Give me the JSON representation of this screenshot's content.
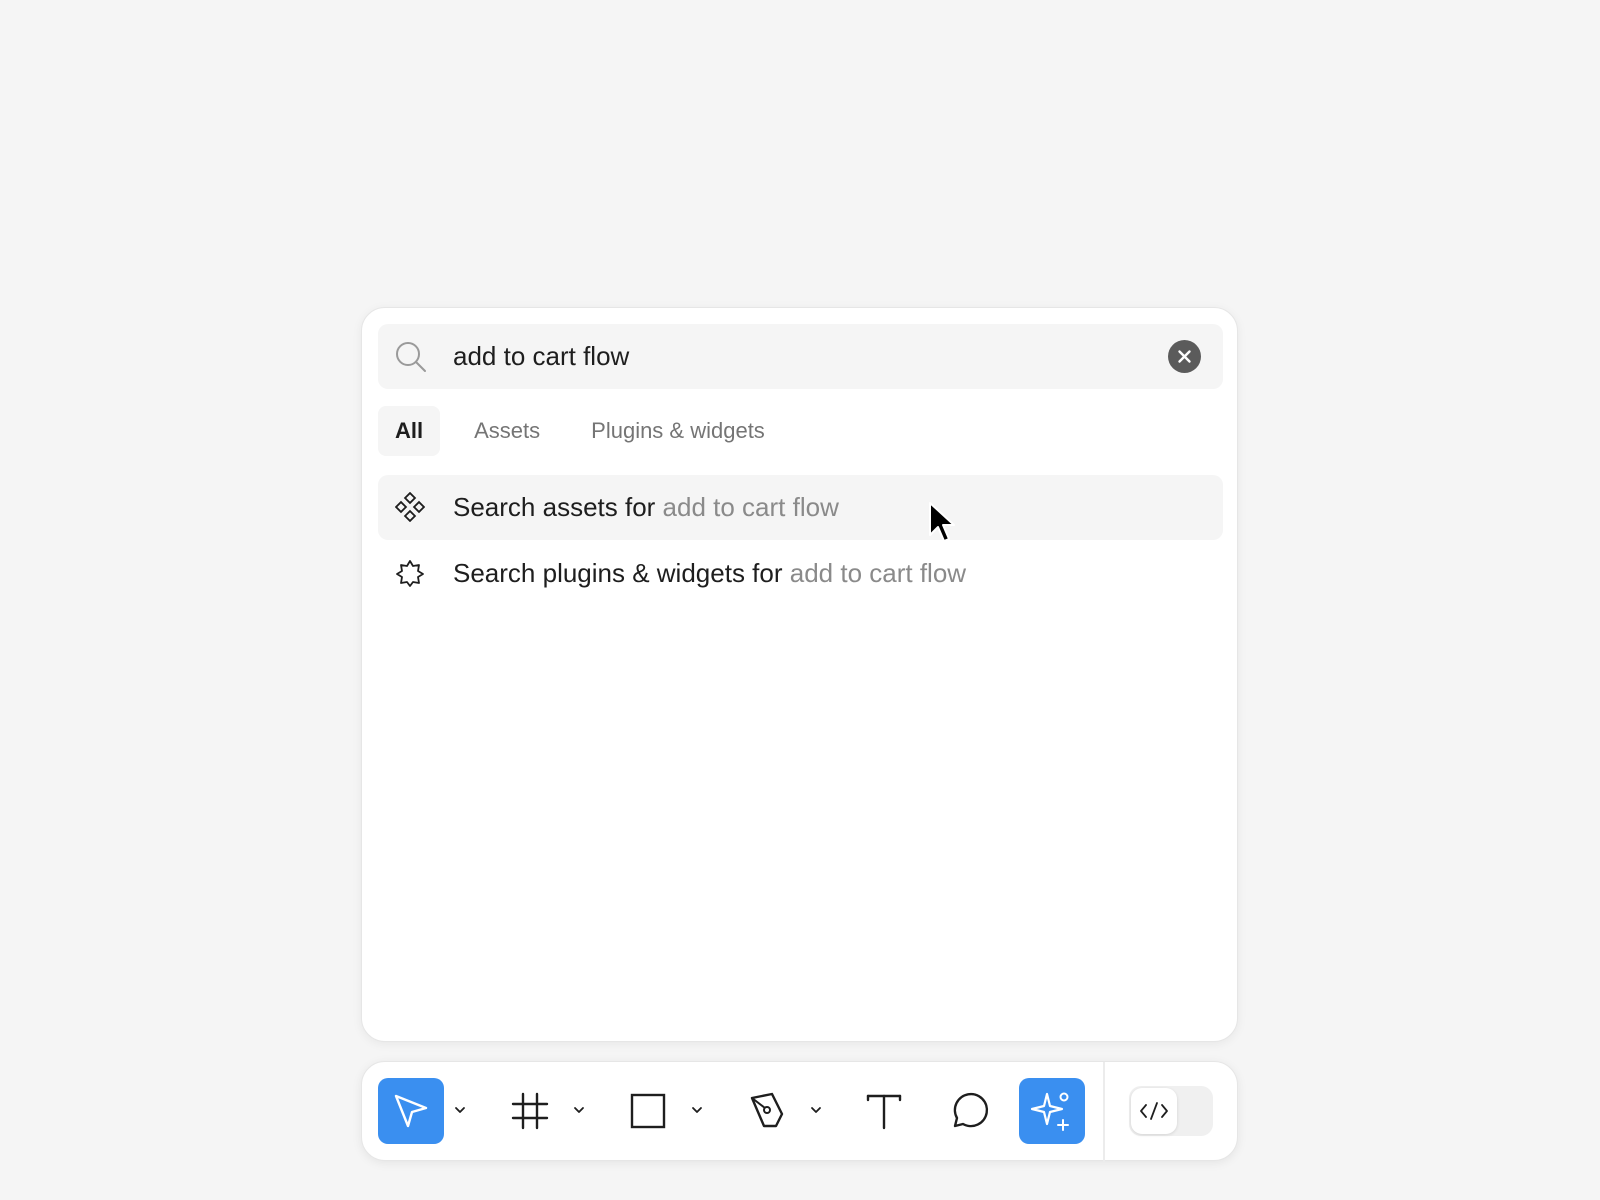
{
  "search": {
    "query": "add to cart flow",
    "clear_icon": "close-circle-icon"
  },
  "tabs": [
    {
      "label": "All",
      "active": true
    },
    {
      "label": "Assets",
      "active": false
    },
    {
      "label": "Plugins & widgets",
      "active": false
    }
  ],
  "results": [
    {
      "icon": "component-icon",
      "prefix": "Search assets for",
      "term": "add to cart flow",
      "hovered": true
    },
    {
      "icon": "plugin-icon",
      "prefix": "Search plugins & widgets for",
      "term": "add to cart flow",
      "hovered": false
    }
  ],
  "toolbar": {
    "tools": [
      {
        "name": "move-tool",
        "icon": "pointer-icon",
        "active": true,
        "has_menu": true
      },
      {
        "name": "frame-tool",
        "icon": "frame-icon",
        "active": false,
        "has_menu": true
      },
      {
        "name": "shape-tool",
        "icon": "rectangle-icon",
        "active": false,
        "has_menu": true
      },
      {
        "name": "pen-tool",
        "icon": "pen-icon",
        "active": false,
        "has_menu": true
      },
      {
        "name": "text-tool",
        "icon": "text-icon",
        "active": false,
        "has_menu": false
      },
      {
        "name": "comment-tool",
        "icon": "comment-icon",
        "active": false,
        "has_menu": false
      },
      {
        "name": "actions-tool",
        "icon": "sparkle-icon",
        "active": true,
        "has_menu": false
      }
    ],
    "dev_mode_icon": "code-icon",
    "dev_mode_on": false
  },
  "colors": {
    "accent": "#3a8ff0",
    "muted_text": "#8a8a8a",
    "background": "#f5f5f5"
  }
}
